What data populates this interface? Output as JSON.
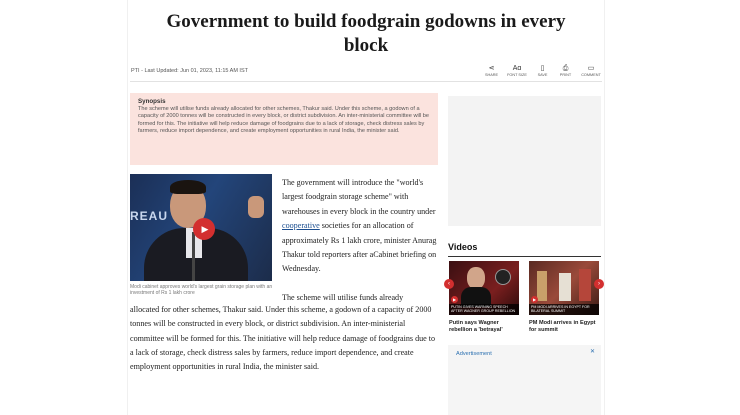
{
  "article": {
    "headline": "Government to build foodgrain godowns in every block",
    "byline": "PTI - Last Updated: Jun 01, 2023, 11:15 AM IST",
    "actions": [
      {
        "icon": "share-icon",
        "glyph": "⋖",
        "label": "SHARE"
      },
      {
        "icon": "font-size-icon",
        "glyph": "Aɑ",
        "label": "FONT SIZE"
      },
      {
        "icon": "bookmark-icon",
        "glyph": "▯",
        "label": "SAVE"
      },
      {
        "icon": "print-icon",
        "glyph": "⎙",
        "label": "PRINT"
      },
      {
        "icon": "comment-icon",
        "glyph": "▭",
        "label": "COMMENT"
      }
    ],
    "synopsis": {
      "title": "Synopsis",
      "body": "The scheme will utilise funds already allocated for other schemes, Thakur said. Under this scheme, a godown of a capacity of 2000 tonnes will be constructed in every block, or district subdivision. An inter-ministerial committee will be formed for this. The initiative will help reduce damage of foodgrains due to a lack of storage, check distress sales by farmers, reduce import dependence, and create employment opportunities in rural India, the minister said."
    },
    "photo": {
      "bg_text": "REAU",
      "caption": "Modi cabinet approves world's largest grain storage plan with an investment of Rs 1 lakh crore"
    },
    "para1_before_link": "The government will introduce the \"world's largest foodgrain storage scheme\" with warehouses in every block in the country under ",
    "para1_link": "cooperative",
    "para1_after_link": " societies for an allocation of approximately Rs 1 lakh crore, minister Anurag Thakur told reporters after aCabinet briefing on Wednesday.",
    "para2_start": "The scheme will utilise funds already",
    "para2_rest": "allocated for other schemes, Thakur said. Under this scheme, a godown of a capacity of 2000 tonnes will be constructed in every block, or district subdivision. An inter-ministerial committee will be formed for this. The initiative will help reduce damage of foodgrains due to a lack of storage, check distress sales by farmers, reduce import dependence, and create employment opportunities in rural India, the minister said."
  },
  "sidebar": {
    "videos_title": "Videos",
    "videos": [
      {
        "caption": "Putin says Wagner rebellion a 'betrayal'",
        "strip": "PUTIN GIVES WARNING SPEECH AFTER WAGNER GROUP REBELLION",
        "color": "#7a1f1f"
      },
      {
        "caption": "PM Modi arrives in Egypt for summit",
        "strip": "PM MODI ARRIVES IN EGYPT FOR BILATERAL SUMMIT",
        "color": "#8a3a2e"
      }
    ],
    "prev_arrow": "‹",
    "next_arrow": "›",
    "ad_label": "Advertisement",
    "ad_close": "✕"
  },
  "colors": {
    "synopsis_bg": "#fbe3de",
    "link": "#1a4d8f",
    "accent_red": "#d32f2f"
  }
}
